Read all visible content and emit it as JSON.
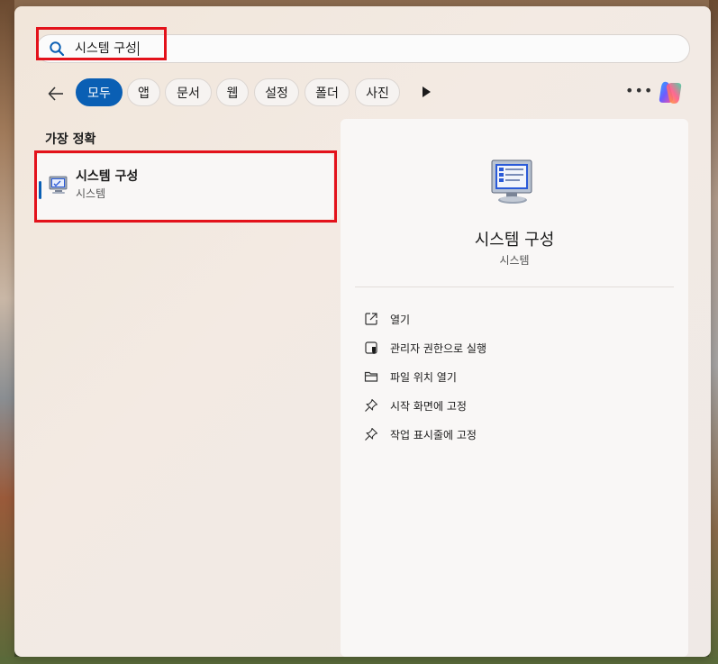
{
  "search": {
    "query": "시스템 구성",
    "icon": "search-icon"
  },
  "filters": {
    "back_icon": "back-arrow-icon",
    "chips": [
      "모두",
      "앱",
      "문서",
      "웹",
      "설정",
      "폴더",
      "사진"
    ],
    "active_chip": "모두",
    "more_icon": "play-icon",
    "overflow_icon": "more-icon",
    "copilot_icon": "copilot-icon"
  },
  "results": {
    "section_title": "가장 정확",
    "best_match": {
      "title": "시스템 구성",
      "subtitle": "시스템",
      "icon": "system-configuration-icon"
    }
  },
  "detail": {
    "title": "시스템 구성",
    "subtitle": "시스템",
    "actions": [
      {
        "label": "열기",
        "icon": "open-external-icon"
      },
      {
        "label": "관리자 권한으로 실행",
        "icon": "shield-icon"
      },
      {
        "label": "파일 위치 열기",
        "icon": "folder-icon"
      },
      {
        "label": "시작 화면에 고정",
        "icon": "pin-icon"
      },
      {
        "label": "작업 표시줄에 고정",
        "icon": "pin-icon"
      }
    ]
  },
  "colors": {
    "accent": "#0a5fb4",
    "highlight": "#e3121b"
  }
}
